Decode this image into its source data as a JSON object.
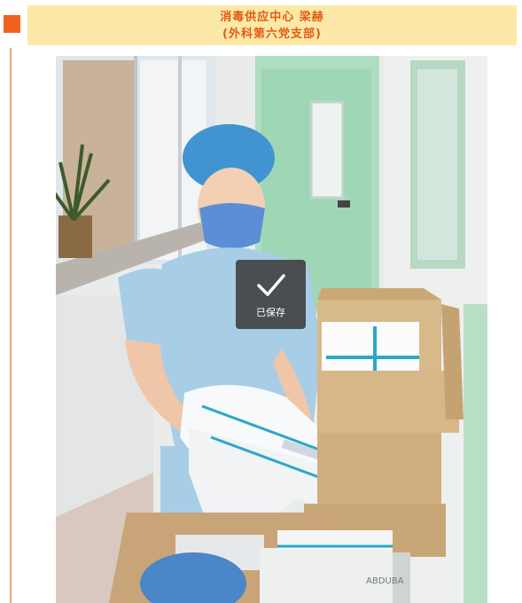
{
  "caption": {
    "line1": "消毒供应中心 梁赫",
    "line2": "(外科第六党支部)"
  },
  "photo": {
    "icon": "photo-image",
    "box_label": "ABDUBA"
  },
  "toast": {
    "icon": "checkmark-icon",
    "label": "已保存"
  },
  "colors": {
    "accent": "#f0631f",
    "caption_bg": "#fde9a7",
    "caption_text": "#e25a14"
  }
}
